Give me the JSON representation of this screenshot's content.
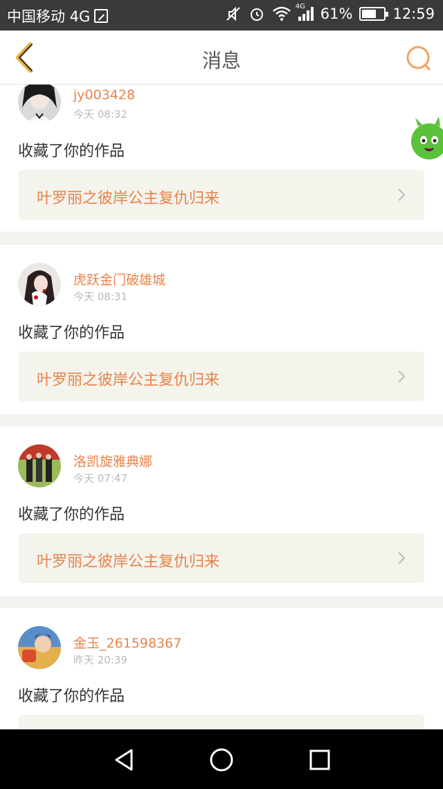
{
  "status_bar": {
    "carrier": "中国移动 4G",
    "network_badge": "4G",
    "battery_percent": "61%",
    "time": "12:59",
    "icons": [
      "sim-icon",
      "mute-icon",
      "alarm-icon",
      "wifi-icon",
      "signal-icon",
      "battery-icon"
    ]
  },
  "header": {
    "title": "消息",
    "back_icon": "chevron-left-icon",
    "search_icon": "search-icon",
    "accent_color": "#f0a35e"
  },
  "messages": [
    {
      "username": "jy003428",
      "time": "今天 08:32",
      "action": "收藏了你的作品",
      "work_title": "叶罗丽之彼岸公主复仇归来"
    },
    {
      "username": "虎跃金门破雄城",
      "time": "今天 08:31",
      "action": "收藏了你的作品",
      "work_title": "叶罗丽之彼岸公主复仇归来"
    },
    {
      "username": "洛凯旋雅典娜",
      "time": "今天 07:47",
      "action": "收藏了你的作品",
      "work_title": "叶罗丽之彼岸公主复仇归来"
    },
    {
      "username": "金玉_261598367",
      "time": "昨天 20:39",
      "action": "收藏了你的作品",
      "work_title": ""
    }
  ],
  "colors": {
    "username": "#e8834b",
    "work_title": "#e8834b",
    "work_bg": "#f4f3ec",
    "separator": "#f3f2ee"
  },
  "nav_bar": {
    "icons": [
      "back-triangle-icon",
      "home-circle-icon",
      "recents-square-icon"
    ]
  }
}
